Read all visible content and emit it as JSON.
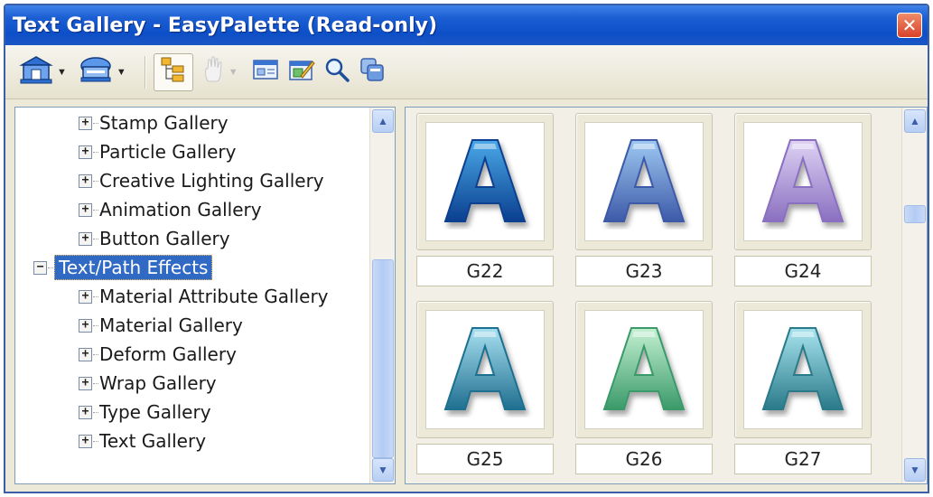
{
  "window": {
    "title": "Text Gallery - EasyPalette (Read-only)",
    "close_symbol": "✕"
  },
  "toolbar": {
    "buttons": [
      {
        "icon": "home-gallery-icon",
        "dropdown": true
      },
      {
        "icon": "object-gallery-icon",
        "dropdown": true
      },
      {
        "icon": "tree-view-icon",
        "active": true
      },
      {
        "icon": "hand-icon",
        "dropdown": true,
        "disabled": true
      },
      {
        "icon": "properties-icon"
      },
      {
        "icon": "edit-icon"
      },
      {
        "icon": "search-icon"
      },
      {
        "icon": "duplicate-icon"
      }
    ]
  },
  "tree": {
    "items": [
      {
        "label": "Stamp Gallery",
        "expander": "+",
        "level": 2
      },
      {
        "label": "Particle Gallery",
        "expander": "+",
        "level": 2
      },
      {
        "label": "Creative Lighting Gallery",
        "expander": "+",
        "level": 2
      },
      {
        "label": "Animation Gallery",
        "expander": "+",
        "level": 2
      },
      {
        "label": "Button Gallery",
        "expander": "+",
        "level": 2
      },
      {
        "label": "Text/Path Effects",
        "expander": "−",
        "level": 1,
        "selected": true
      },
      {
        "label": "Material Attribute Gallery",
        "expander": "+",
        "level": 2
      },
      {
        "label": "Material Gallery",
        "expander": "+",
        "level": 2
      },
      {
        "label": "Deform Gallery",
        "expander": "+",
        "level": 2
      },
      {
        "label": "Wrap Gallery",
        "expander": "+",
        "level": 2
      },
      {
        "label": "Type Gallery",
        "expander": "+",
        "level": 2
      },
      {
        "label": "Text Gallery",
        "expander": "+",
        "level": 2
      }
    ]
  },
  "gallery": {
    "items": [
      {
        "label": "G22",
        "glyph": "A",
        "color_top": "#4aa8e8",
        "color_bottom": "#0a3f8f"
      },
      {
        "label": "G23",
        "glyph": "A",
        "color_top": "#9ec8f2",
        "color_bottom": "#3d5aa8"
      },
      {
        "label": "G24",
        "glyph": "A",
        "color_top": "#ded2f4",
        "color_bottom": "#8a6fc0"
      },
      {
        "label": "G25",
        "glyph": "A",
        "color_top": "#a8e0f0",
        "color_bottom": "#1f6f90"
      },
      {
        "label": "G26",
        "glyph": "A",
        "color_top": "#c4f0d2",
        "color_bottom": "#3a9a6a"
      },
      {
        "label": "G27",
        "glyph": "A",
        "color_top": "#a8e4ee",
        "color_bottom": "#2a7a8a"
      }
    ]
  },
  "colors": {
    "titlebar": "#0d4fc8",
    "selection": "#316ac5",
    "window_bg": "#ece9d8"
  }
}
